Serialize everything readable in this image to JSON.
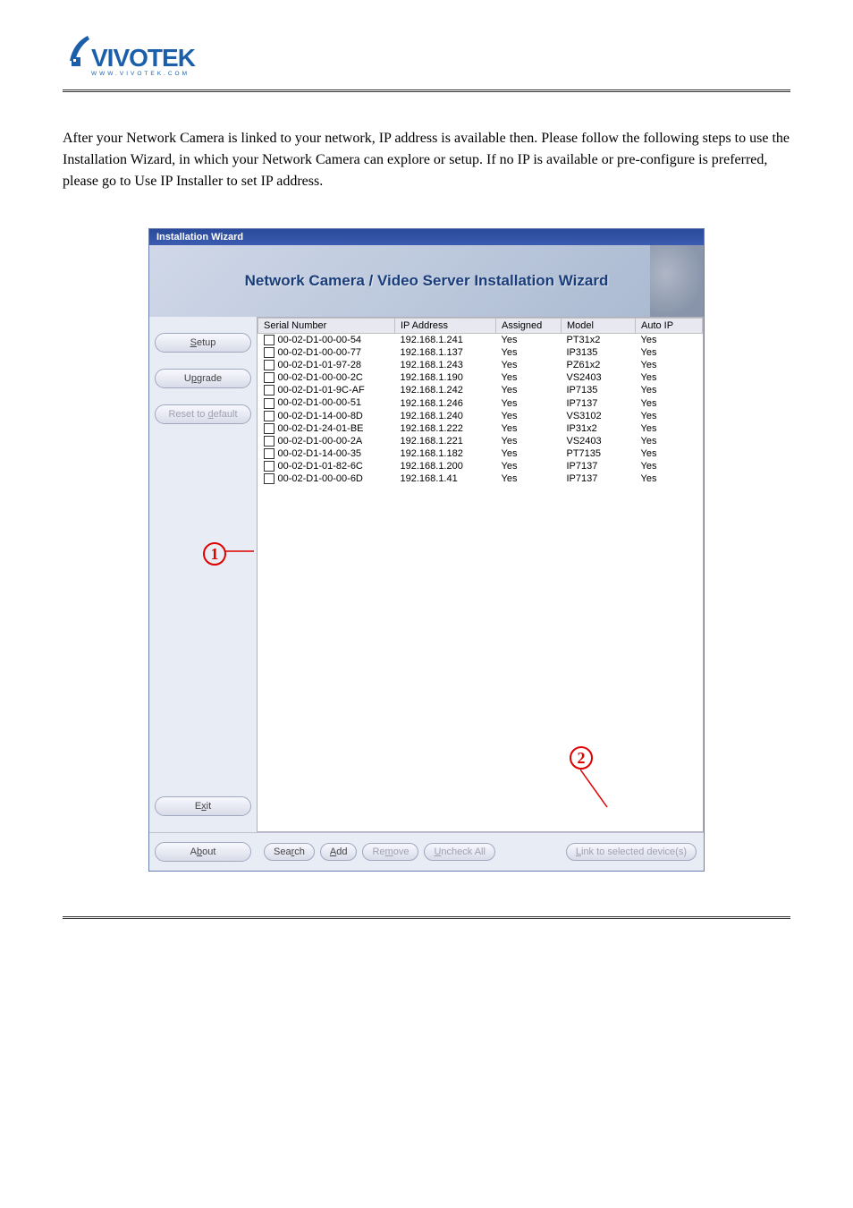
{
  "window_title": "Installation Wizard",
  "banner_title": "Network Camera / Video Server Installation Wizard",
  "intro": "After your Network Camera is linked to your network, IP address is available then. Please follow the following steps to use the Installation Wizard, in which your Network Camera can explore or setup. If no IP is available or pre-configure is preferred, please go to Use IP Installer to set IP address.",
  "sidebar": {
    "setup": "Setup",
    "upgrade": "Upgrade",
    "reset": "Reset to default",
    "exit": "Exit",
    "about": "About"
  },
  "table": {
    "headers": {
      "serial": "Serial Number",
      "ip": "IP Address",
      "assigned": "Assigned",
      "model": "Model",
      "autoip": "Auto IP"
    },
    "rows": [
      {
        "serial": "00-02-D1-00-00-54",
        "ip": "192.168.1.241",
        "assigned": "Yes",
        "model": "PT31x2",
        "autoip": "Yes"
      },
      {
        "serial": "00-02-D1-00-00-77",
        "ip": "192.168.1.137",
        "assigned": "Yes",
        "model": "IP3135",
        "autoip": "Yes"
      },
      {
        "serial": "00-02-D1-01-97-28",
        "ip": "192.168.1.243",
        "assigned": "Yes",
        "model": "PZ61x2",
        "autoip": "Yes"
      },
      {
        "serial": "00-02-D1-00-00-2C",
        "ip": "192.168.1.190",
        "assigned": "Yes",
        "model": "VS2403",
        "autoip": "Yes"
      },
      {
        "serial": "00-02-D1-01-9C-AF",
        "ip": "192.168.1.242",
        "assigned": "Yes",
        "model": "IP7135",
        "autoip": "Yes"
      },
      {
        "serial": "00-02-D1-00-00-51",
        "ip": "192.168.1.246",
        "assigned": "Yes",
        "model": "IP7137",
        "autoip": "Yes"
      },
      {
        "serial": "00-02-D1-14-00-8D",
        "ip": "192.168.1.240",
        "assigned": "Yes",
        "model": "VS3102",
        "autoip": "Yes"
      },
      {
        "serial": "00-02-D1-24-01-BE",
        "ip": "192.168.1.222",
        "assigned": "Yes",
        "model": "IP31x2",
        "autoip": "Yes"
      },
      {
        "serial": "00-02-D1-00-00-2A",
        "ip": "192.168.1.221",
        "assigned": "Yes",
        "model": "VS2403",
        "autoip": "Yes"
      },
      {
        "serial": "00-02-D1-14-00-35",
        "ip": "192.168.1.182",
        "assigned": "Yes",
        "model": "PT7135",
        "autoip": "Yes"
      },
      {
        "serial": "00-02-D1-01-82-6C",
        "ip": "192.168.1.200",
        "assigned": "Yes",
        "model": "IP7137",
        "autoip": "Yes"
      },
      {
        "serial": "00-02-D1-00-00-6D",
        "ip": "192.168.1.41",
        "assigned": "Yes",
        "model": "IP7137",
        "autoip": "Yes"
      }
    ]
  },
  "buttons": {
    "search": "Search",
    "add": "Add",
    "remove": "Remove",
    "uncheck": "Uncheck All",
    "link": "Link to selected device(s)"
  },
  "callouts": {
    "one": "1",
    "two": "2"
  },
  "footer_text": ""
}
